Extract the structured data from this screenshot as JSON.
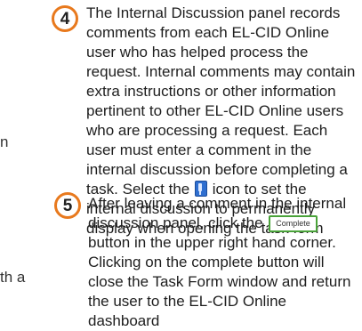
{
  "left_fragments": [
    "n",
    "th a"
  ],
  "steps": [
    {
      "number": "4",
      "text_before_icon": "The Internal Discussion panel records comments from each EL-CID Online user who has helped process the request. Internal comments may contain extra instructions or other information pertinent to other EL-CID Online users who are processing a request. Each user must enter a comment in the internal discussion before completing a task. Select the",
      "icon": "pin-icon",
      "text_after_icon": "icon to set the internal discussion to permanently display when opening the task form"
    },
    {
      "number": "5",
      "text_before_button": "After leaving a comment in the internal discussion panel, click the",
      "button_label": "Complete",
      "text_after_button": "button in the upper right hand corner. Clicking on the complete button will close the Task Form window and return the user to the EL-CID Online dashboard"
    }
  ],
  "colors": {
    "badge_border": "#e8791d",
    "button_border": "#4aa33a",
    "icon": "#2f6fd0"
  }
}
